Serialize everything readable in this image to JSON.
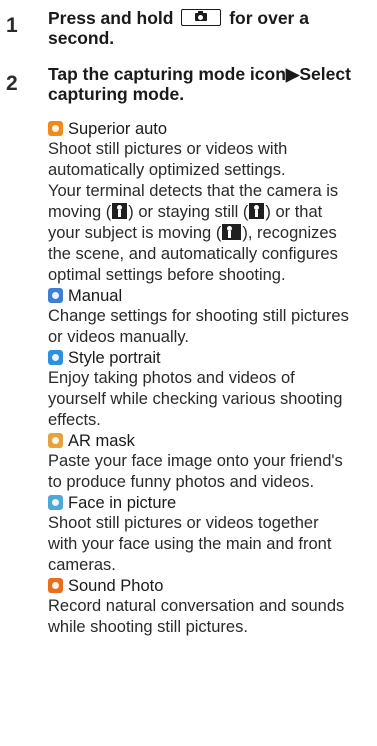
{
  "steps": [
    {
      "num": "1",
      "text_before": "Press and hold",
      "text_after": "for over a second.",
      "key_icon": "camera-key-icon"
    },
    {
      "num": "2",
      "text": "Tap the capturing mode icon▶Select capturing mode."
    }
  ],
  "modes": [
    {
      "icon": "superior-auto-icon",
      "color": "#f08a1c",
      "name": "Superior auto",
      "lines": [
        "Shoot still pictures or videos with",
        "automatically optimized settings.",
        "Your terminal detects that the camera is",
        "moving (|walk|) or staying still (|still|) or that",
        "your subject is moving (|run|), recognizes",
        "the scene, and automatically configures",
        "optimal settings before shooting."
      ]
    },
    {
      "icon": "manual-icon",
      "color": "#3e7fd6",
      "name": "Manual",
      "lines": [
        "Change settings for shooting still pictures",
        "or videos manually."
      ]
    },
    {
      "icon": "style-portrait-icon",
      "color": "#2f8fe0",
      "name": "Style portrait",
      "lines": [
        "Enjoy taking photos and videos of",
        "yourself while checking various shooting",
        "effects."
      ]
    },
    {
      "icon": "ar-mask-icon",
      "color": "#e6a23c",
      "name": "AR mask",
      "lines": [
        "Paste your face image onto your friend's",
        "to produce funny photos and videos."
      ]
    },
    {
      "icon": "face-in-picture-icon",
      "color": "#4fa8d8",
      "name": "Face in picture",
      "lines": [
        "Shoot still pictures or videos together",
        "with your face using the main and front",
        "cameras."
      ]
    },
    {
      "icon": "sound-photo-icon",
      "color": "#e8701c",
      "name": "Sound Photo",
      "lines": [
        "Record natural conversation and sounds",
        "while shooting still pictures."
      ]
    }
  ]
}
